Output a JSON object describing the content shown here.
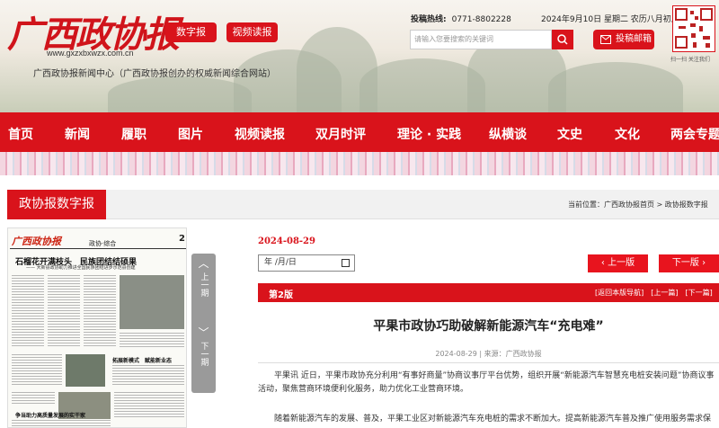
{
  "header": {
    "logo_text": "广西政协报",
    "logo_url": "www.gxzxbxwzx.com.cn",
    "subtitle": "广西政协报新闻中心（广西政协报创办的权威新闻综合网站）",
    "digital_paper_label": "数字报",
    "video_label": "视频读报",
    "hotline_label": "投稿热线:",
    "hotline_number": "0771-8802228",
    "date_text": "2024年9月10日 星期二 农历八月初八",
    "search_placeholder": "请输入您要搜索的关键词",
    "submit_label": "投稿邮箱",
    "qr_caption": "扫一扫 关注我们"
  },
  "nav": {
    "items": [
      "首页",
      "新闻",
      "履职",
      "图片",
      "视频读报",
      "双月时评",
      "理论 · 实践",
      "纵横谈",
      "文史",
      "文化",
      "两会专题"
    ]
  },
  "section": {
    "title": "政协报数字报",
    "breadcrumb": "当前位置：广西政协报首页 > 政协报数字报"
  },
  "paper_thumb": {
    "brand": "广西政协报",
    "section": "政协·综合",
    "page_no": "2",
    "headline": "石榴花开满枝头　民族团结结硕果",
    "subheadline": "—— 大新县政协助力推进全国民族团结进步示范县创建",
    "headline_2": "拓展新模式　赋能新业态",
    "headline_3": "争当助力高质量发展的实干家"
  },
  "pager": {
    "up_label": "上一期",
    "down_label": "下一期"
  },
  "article": {
    "date": "2024-08-29",
    "date_input_text": "年 /月/日",
    "prev_label": "上一版",
    "next_label": "下一版",
    "edition": "第2版",
    "edition_links": "[返回本版导航]　[上一篇]　[下一篇]",
    "title": "平果市政协巧助破解新能源汽车“充电难”",
    "meta": "2024-08-29 | 来源：广西政协报",
    "paragraphs": [
      "平果讯 近日，平果市政协充分利用“有事好商量”协商议事厅平台优势，组织开展“新能源汽车智慧充电桩安装问题”协商议事活动，聚焦营商环境便利化服务，助力优化工业营商环境。",
      "随着新能源汽车的发展、普及，平果工业区对新能源汽车充电桩的需求不断加大。提高新能源汽车普及推广使用服务需求保"
    ]
  }
}
